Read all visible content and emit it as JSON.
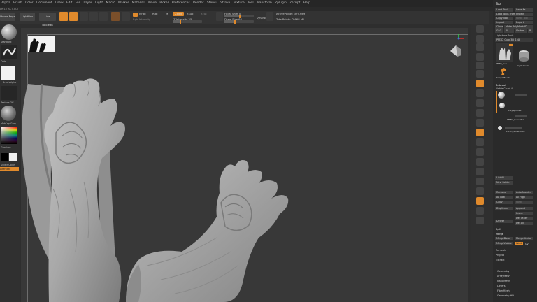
{
  "menu": [
    "Alpha",
    "Brush",
    "Color",
    "Document",
    "Draw",
    "Edit",
    "File",
    "Layer",
    "Light",
    "Macro",
    "Marker",
    "Material",
    "Movie",
    "Picker",
    "Preferences",
    "Render",
    "Stencil",
    "Stroke",
    "Texture",
    "Tool",
    "Transform",
    "Zplugin",
    "Zscript",
    "Help"
  ],
  "topstrip": "LR:1 | ACT ACT",
  "toolbar": {
    "home_page": "Home Page",
    "lightbox": "LightBox",
    "live_boolean": "Live Boolean",
    "mrgb": "Mrgb",
    "rgb": "Rgb",
    "m": "M",
    "rgb_intensity": "Rgb Intensity",
    "zadd": "Zadd",
    "zsub": "Zsub",
    "zcut": "Zcut",
    "z_intensity": "Z Intensity 25",
    "focal_shift": "Focal Shift 0",
    "draw_size": "Draw Size 64",
    "dynamic": "Dynamic",
    "active_points": "ActivePoints: 379,669",
    "total_points": "TotalPoints: 2.668 Mil"
  },
  "leftshelf": {
    "standard": "Standard",
    "dots": "Dots",
    "brush_alpha": "~BrushAlpha",
    "texture_off": "Texture Off",
    "matcap": "MatCap Gray",
    "gradient": "Gradient",
    "switch_color": "SwitchColor",
    "alternate": "Alternate"
  },
  "tool": {
    "title": "Tool",
    "load_tool": "Load Tool",
    "save_as": "Save As",
    "load_tools_from_project": "Load Tools From Project",
    "copy_tool": "Copy Tool",
    "paste_tool": "Paste Tool",
    "import": "Import",
    "export": "Export",
    "clone": "Clone",
    "make_polymesh": "Make PolyMesh3D",
    "goz": "GoZ",
    "all": "All",
    "visible": "Visible",
    "r": "R",
    "lightbox_tools": "Lightbox▸Tools",
    "pm3d_value": "PM3D_Cube3D_1  48",
    "thumb1": "PM3D_Cub",
    "thumb2": "Cylinder3D",
    "thumb3": "SimpleBrush",
    "subtool": "Subtool",
    "visible_count": "Visible Count 4",
    "sub1": "PolySphere1",
    "sub2": "PM3D_Cube3D1",
    "sub3": "PM3D_Sphere3D1",
    "list_all": "List All",
    "new_folder": "New Folder",
    "rename": "Rename",
    "autoreorder": "AutoReorder",
    "all_low": "All Low",
    "all_high": "All High",
    "copy": "Copy",
    "paste": "Paste",
    "duplicate": "Duplicate",
    "append": "Append",
    "insert": "Insert",
    "delete": "Delete",
    "del_other": "Del Other",
    "del_all": "Del All",
    "split": "Split",
    "merge": "Merge",
    "merge_down": "MergeDown",
    "merge_similar": "MergeSimilar",
    "merge_visible": "MergeVisible",
    "weld": "Weld",
    "uv": "Uv",
    "remesh": "Remesh",
    "project": "Project",
    "extract": "Extract",
    "geometry": "Geometry",
    "arraymesh": "ArrayMesh",
    "nanomesh": "NanoMesh",
    "layers": "Layers",
    "fibermesh": "FiberMesh",
    "geometry_hd": "Geometry HD"
  },
  "colors": {
    "accent": "#e08a2c",
    "bg": "#2e2e2e",
    "canvas": "#383838"
  }
}
